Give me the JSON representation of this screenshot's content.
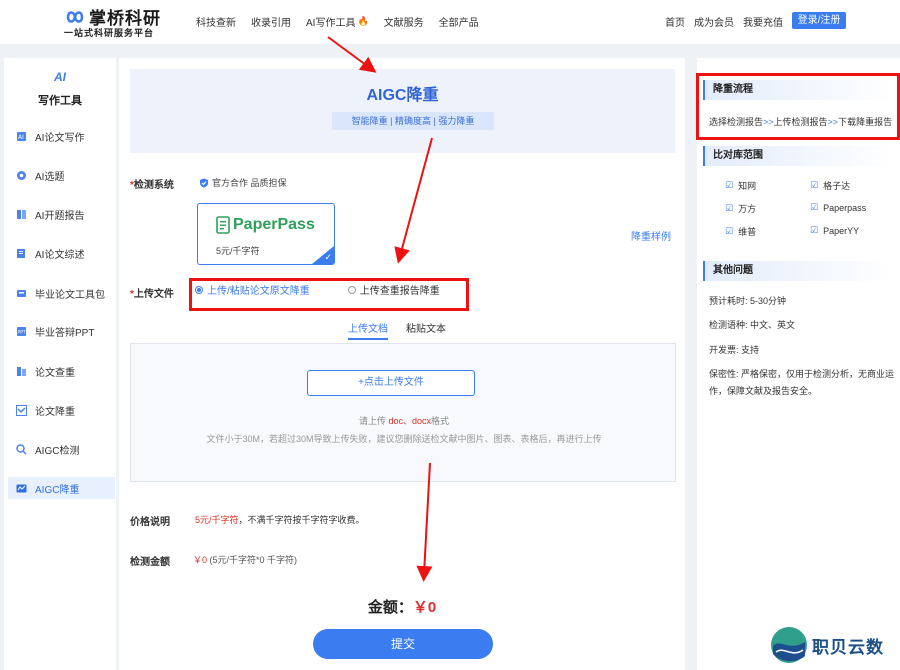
{
  "brand": {
    "name": "掌桥科研",
    "tagline": "一站式科研服务平台"
  },
  "nav": {
    "items": [
      "科技查新",
      "收录引用",
      "AI写作工具",
      "文献服务",
      "全部产品"
    ],
    "right": [
      "首页",
      "成为会员",
      "我要充值"
    ],
    "login": "登录/注册"
  },
  "sidebar": {
    "badge": "AI",
    "title": "写作工具",
    "items": [
      "AI论文写作",
      "AI选题",
      "AI开题报告",
      "AI论文综述",
      "毕业论文工具包",
      "毕业答辩PPT",
      "论文查重",
      "论文降重",
      "AIGC检测",
      "AIGC降重"
    ],
    "active_index": 9
  },
  "main": {
    "title": "AIGC降重",
    "tags": "智能降重 | 精确度高 | 强力降重",
    "system_label": "检测系统",
    "system_note": "官方合作 品质担保",
    "card": {
      "name": "PaperPass",
      "price": "5元/千字符"
    },
    "sample_link": "降重样例",
    "upload_label": "上传文件",
    "upload_options": [
      "上传/粘贴论文原文降重",
      "上传查重报告降重"
    ],
    "tabs": [
      "上传文档",
      "粘贴文本"
    ],
    "upload_button": "+点击上传文件",
    "hint_prefix": "请上传 ",
    "hint_formats": "doc、docx",
    "hint_suffix": "格式",
    "hint_size": "文件小于30M，若超过30M导致上传失败，建议您删除送检文献中图片、图表、表格后，再进行上传",
    "price_label": "价格说明",
    "price_red": "5元/千字符",
    "price_rest": "，不满千字符按千字符字收费。",
    "amount_label": "检测金额",
    "amount_red": "￥0",
    "amount_rest": " (5元/千字符*0 千字符)",
    "total_label": "金额：",
    "total_value": "￥0",
    "submit": "提交"
  },
  "right": {
    "flow_title": "降重流程",
    "flow_steps": [
      "选择检测报告",
      "上传检测报告",
      "下载降重报告"
    ],
    "flow_sep": ">>",
    "lib_title": "比对库范围",
    "libs": [
      "知网",
      "格子达",
      "万方",
      "Paperpass",
      "维普",
      "PaperYY"
    ],
    "faq_title": "其他问题",
    "faq": [
      "预计耗时: 5-30分钟",
      "检测语种: 中文、英文",
      "开发票: 支持",
      "保密性: 严格保密，仅用于检测分析，无商业运作，保障文献及报告安全。"
    ]
  },
  "watermark": "职贝云数",
  "colors": {
    "accent": "#3b7cf0",
    "annotation": "#ee1111",
    "price": "#d93025"
  }
}
